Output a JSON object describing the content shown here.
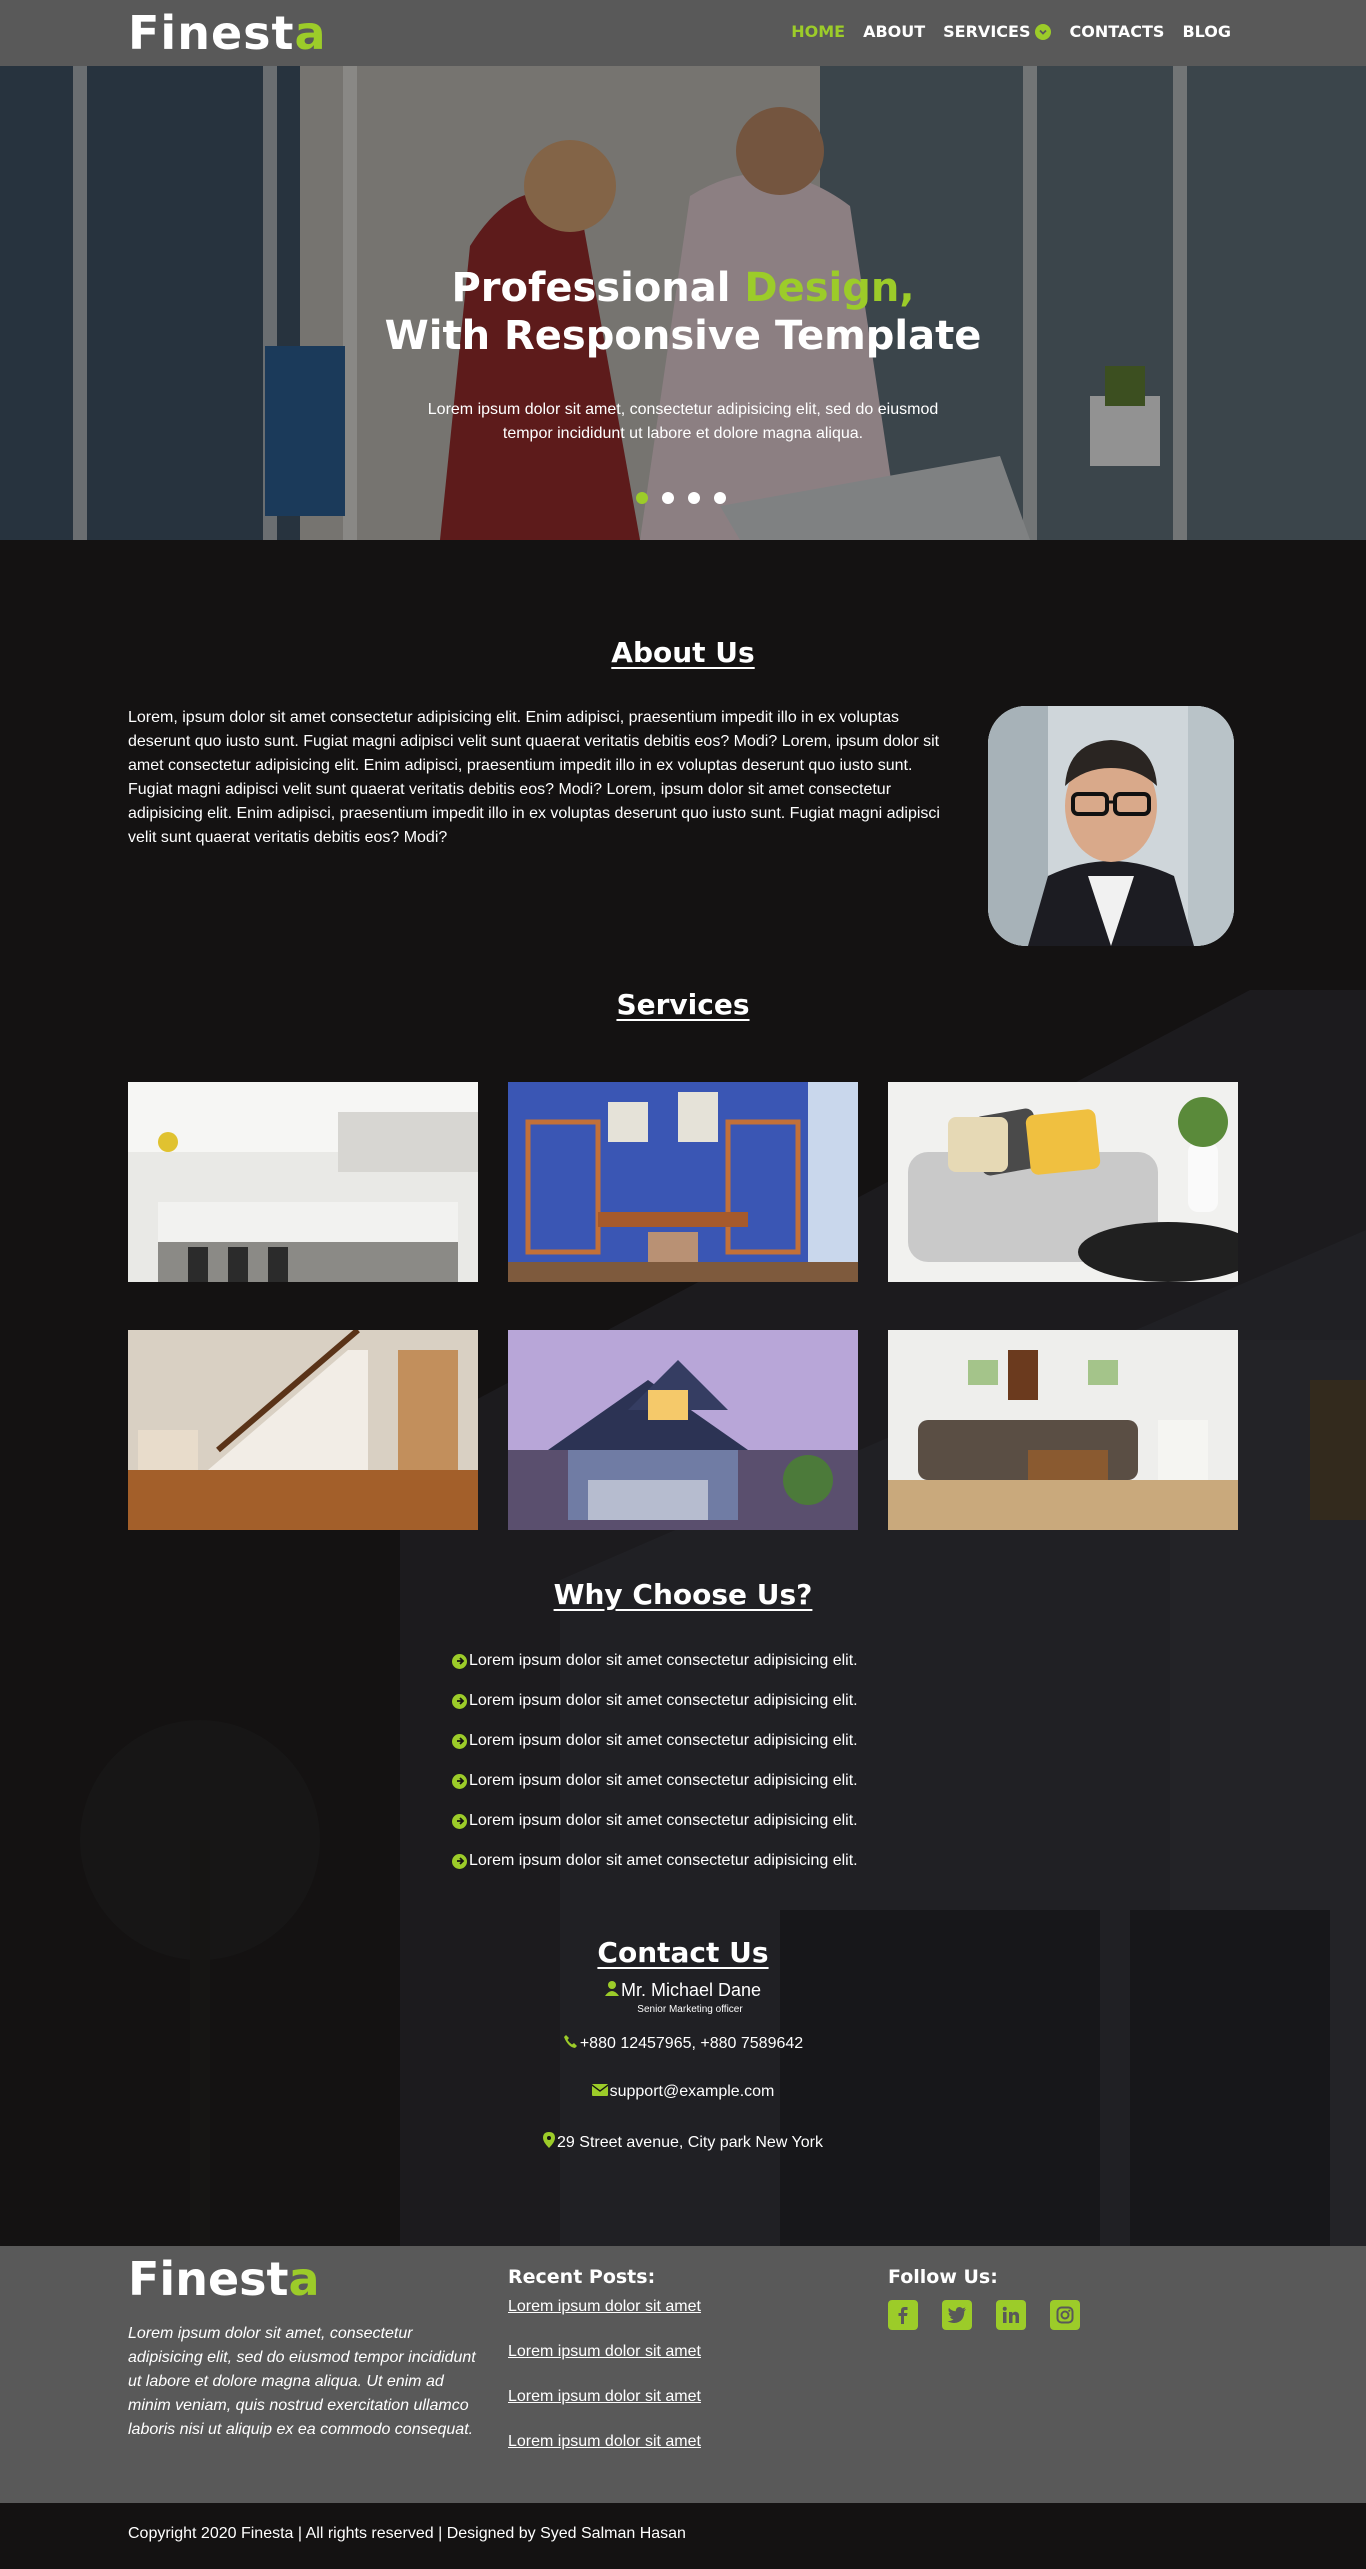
{
  "nav": {
    "brand_part1": "Finest",
    "brand_part2": "a",
    "links": [
      {
        "label": "HOME",
        "active": true
      },
      {
        "label": "ABOUT"
      },
      {
        "label": "SERVICES"
      },
      {
        "label": "CONTACTS"
      },
      {
        "label": "BLOG"
      }
    ]
  },
  "hero": {
    "title_part1": "Professional ",
    "title_accent": "Design,",
    "title_line2": "With Responsive Template",
    "subtitle": "Lorem ipsum dolor sit amet, consectetur adipisicing elit, sed do eiusmod tempor incididunt ut labore et dolore magna aliqua.",
    "slides": 4,
    "active_slide": 1
  },
  "about": {
    "title": "About Us",
    "text": "Lorem, ipsum dolor sit amet consectetur adipisicing elit. Enim adipisci, praesentium impedit illo in ex voluptas deserunt quo iusto sunt. Fugiat magni adipisci velit sunt quaerat veritatis debitis eos? Modi? Lorem, ipsum dolor sit amet consectetur adipisicing elit. Enim adipisci, praesentium impedit illo in ex voluptas deserunt quo iusto sunt. Fugiat magni adipisci velit sunt quaerat veritatis debitis eos? Modi? Lorem, ipsum dolor sit amet consectetur adipisicing elit. Enim adipisci, praesentium impedit illo in ex voluptas deserunt quo iusto sunt. Fugiat magni adipisci velit sunt quaerat veritatis debitis eos? Modi?"
  },
  "services": {
    "title": "Services"
  },
  "why": {
    "title": "Why Choose Us?",
    "items": [
      "Lorem ipsum dolor sit amet consectetur adipisicing elit.",
      "Lorem ipsum dolor sit amet consectetur adipisicing elit.",
      "Lorem ipsum dolor sit amet consectetur adipisicing elit.",
      "Lorem ipsum dolor sit amet consectetur adipisicing elit.",
      "Lorem ipsum dolor sit amet consectetur adipisicing elit.",
      "Lorem ipsum dolor sit amet consectetur adipisicing elit."
    ]
  },
  "contact": {
    "title": "Contact Us",
    "name": "Mr. Michael Dane",
    "role": "Senior Marketing officer",
    "phone": "+880 12457965, +880 7589642",
    "email": "support@example.com",
    "address": "29 Street avenue, City park New York"
  },
  "footer": {
    "brand_part1": "Finest",
    "brand_part2": "a",
    "about": "Lorem ipsum dolor sit amet, consectetur adipisicing elit, sed do eiusmod tempor incididunt ut labore et dolore magna aliqua. Ut enim ad minim veniam, quis nostrud exercitation ullamco laboris nisi ut aliquip ex ea commodo consequat.",
    "recent_title": "Recent Posts:",
    "posts": [
      "Lorem ipsum dolor sit amet",
      "Lorem ipsum dolor sit amet",
      "Lorem ipsum dolor sit amet",
      "Lorem ipsum dolor sit amet"
    ],
    "follow_title": "Follow Us:",
    "social": [
      "facebook-icon",
      "twitter-icon",
      "linkedin-icon",
      "instagram-icon"
    ],
    "copyright": "Copyright 2020 Finesta | All rights reserved | Designed by Syed Salman Hasan"
  },
  "colors": {
    "accent": "#9ccc29",
    "nav_bg": "#595959",
    "dark_bg": "#141212"
  }
}
